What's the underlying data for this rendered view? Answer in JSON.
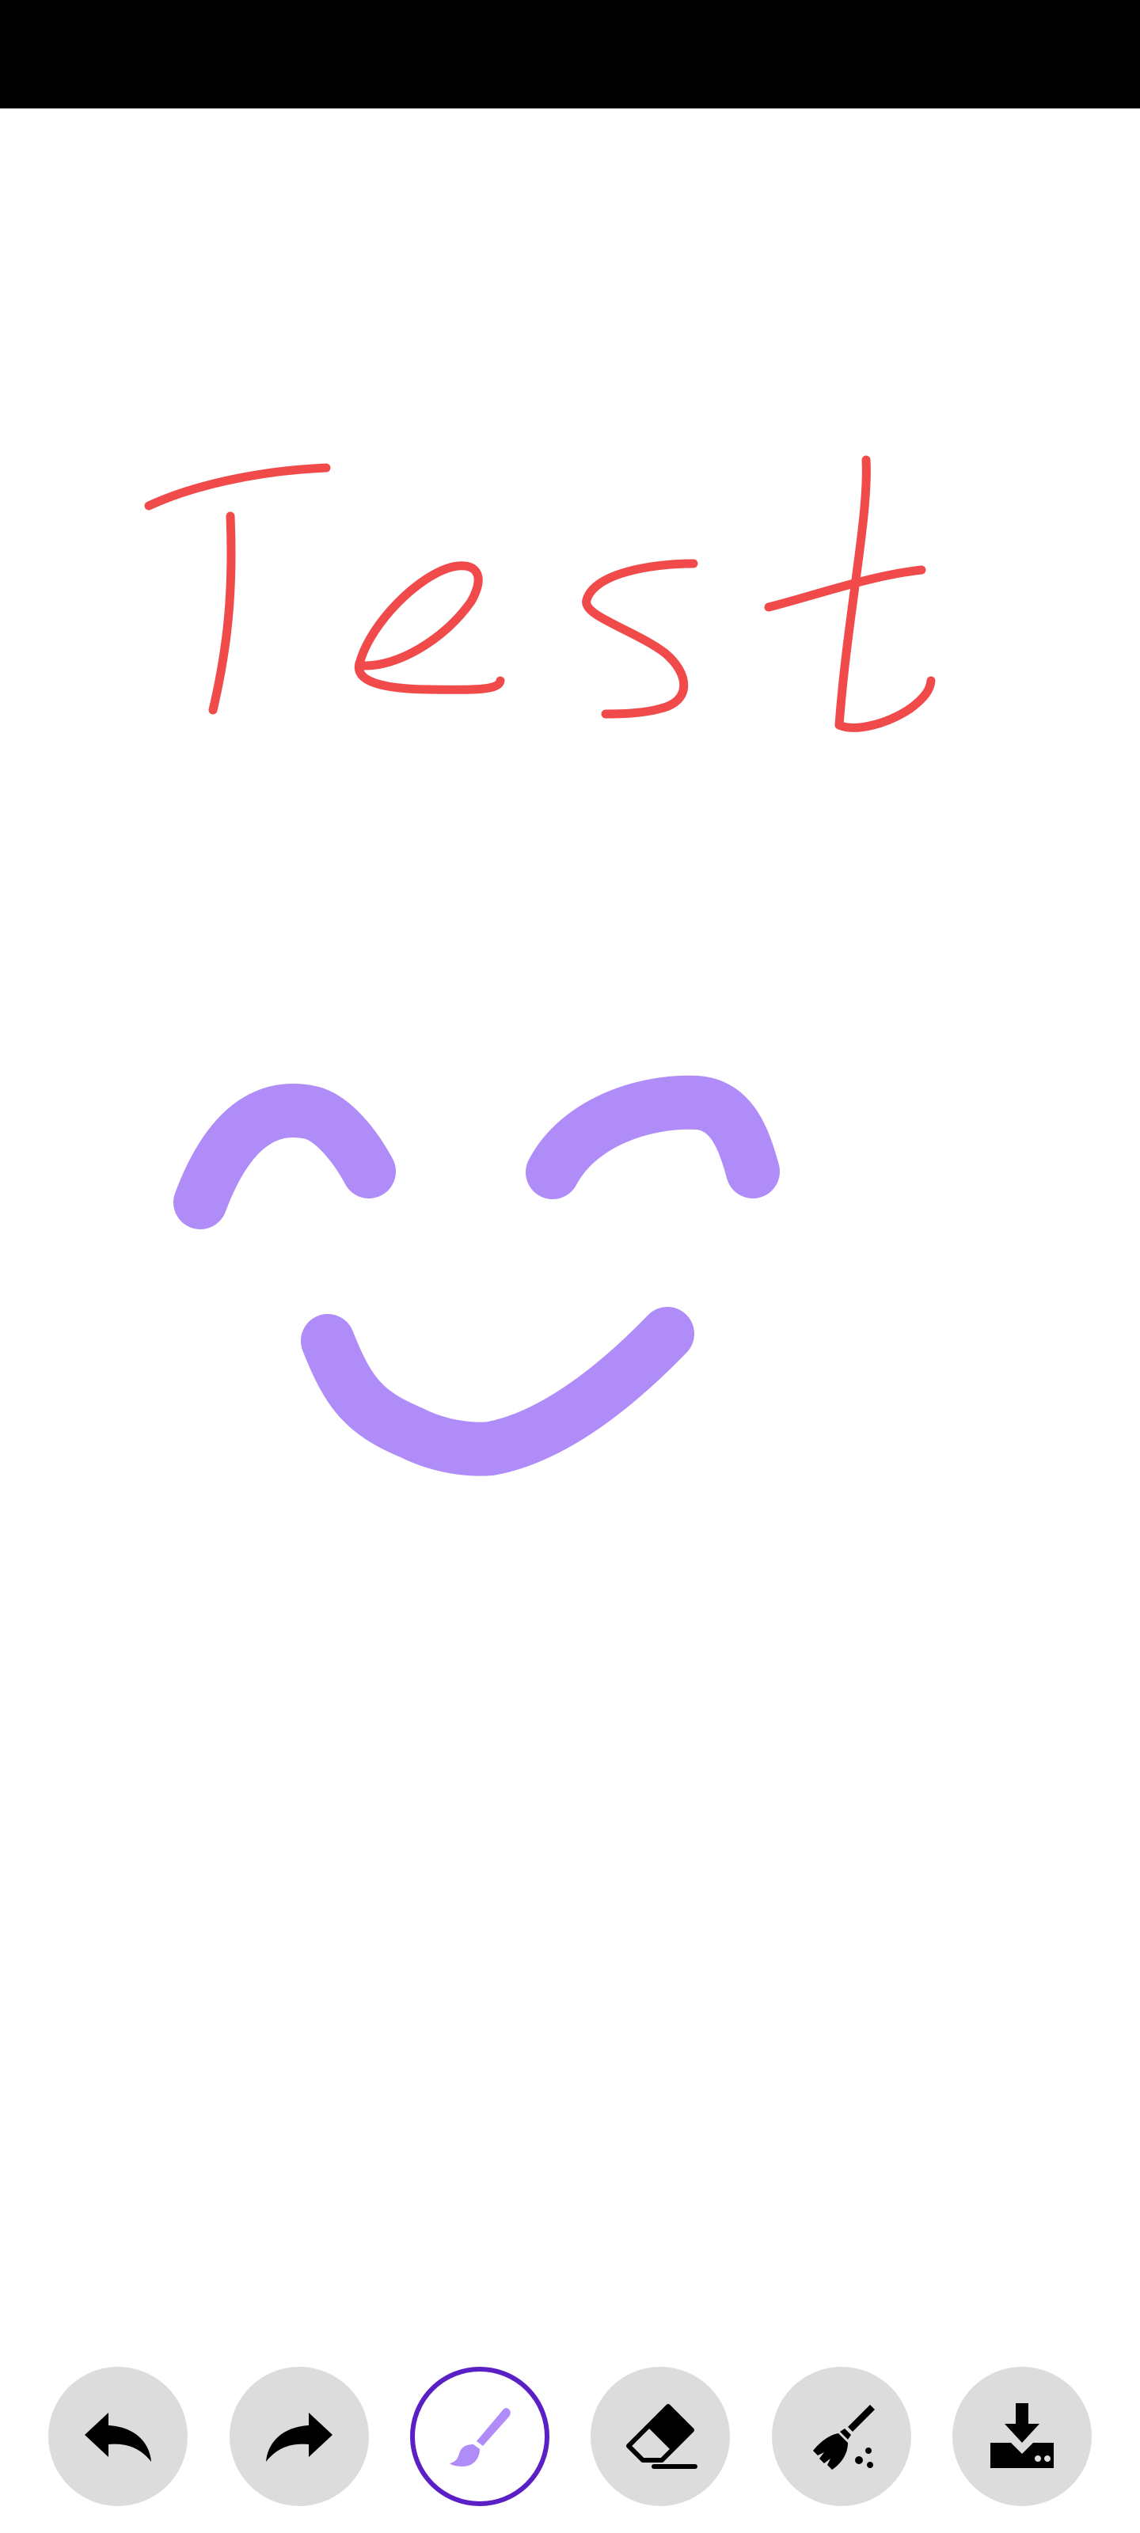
{
  "app": {
    "status_bar_color": "#000000",
    "canvas_background": "#ffffff"
  },
  "drawing": {
    "strokes": [
      {
        "id": "text-test",
        "color": "#f04a4a",
        "description_text": "Test"
      },
      {
        "id": "left-eye",
        "color": "#b08cf8"
      },
      {
        "id": "right-eye",
        "color": "#b08cf8"
      },
      {
        "id": "smile",
        "color": "#b08cf8"
      }
    ]
  },
  "toolbar": {
    "accent_color": "#5b1fc6",
    "button_color": "#dcdcdc",
    "tools": [
      {
        "name": "undo",
        "icon": "undo-icon",
        "active": false
      },
      {
        "name": "redo",
        "icon": "redo-icon",
        "active": false
      },
      {
        "name": "brush",
        "icon": "brush-icon",
        "active": true
      },
      {
        "name": "eraser",
        "icon": "eraser-icon",
        "active": false
      },
      {
        "name": "clear",
        "icon": "broom-icon",
        "active": false
      },
      {
        "name": "save",
        "icon": "download-icon",
        "active": false
      }
    ]
  }
}
